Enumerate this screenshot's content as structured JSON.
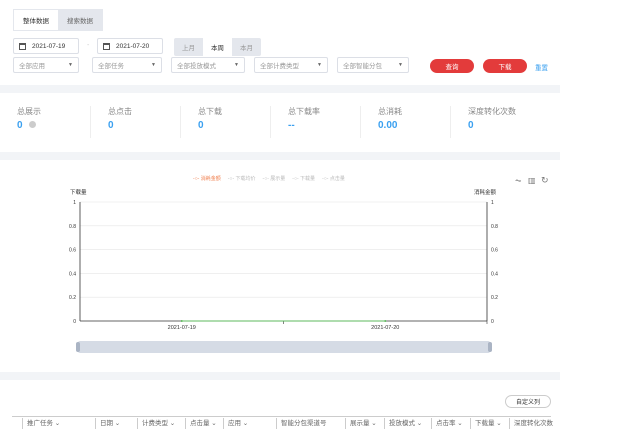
{
  "tabs": [
    "整体数据",
    "搜索数据"
  ],
  "filters": {
    "start_date": "2021-07-19",
    "end_date": "2021-07-20",
    "date_sep": "-",
    "periods": [
      "上月",
      "本周",
      "本月"
    ],
    "selects": [
      "全部应用",
      "全部任务",
      "全部投放模式",
      "全部计费类型",
      "全部智能分包"
    ],
    "query": "查询",
    "download": "下载",
    "reset": "重置"
  },
  "stats": [
    {
      "label": "总展示",
      "value": "0"
    },
    {
      "label": "总点击",
      "value": "0"
    },
    {
      "label": "总下载",
      "value": "0"
    },
    {
      "label": "总下载率",
      "value": "--"
    },
    {
      "label": "总消耗",
      "value": "0.00"
    },
    {
      "label": "深度转化次数",
      "value": "0"
    }
  ],
  "chart_data": {
    "type": "line",
    "legend": [
      "消耗金额",
      "下载均价",
      "展示量",
      "下载量",
      "点击量"
    ],
    "active_series": "消耗金额",
    "ylabel_left": "下载量",
    "ylabel_right": "消耗金额",
    "x": [
      "2021-07-19",
      "2021-07-20"
    ],
    "yticks": [
      "0",
      "0.2",
      "0.4",
      "0.6",
      "0.8",
      "1"
    ],
    "ylim": [
      0,
      1
    ],
    "series": [
      {
        "name": "消耗金额",
        "values": [
          0,
          0
        ]
      }
    ]
  },
  "table": {
    "custom_columns": "自定义列",
    "columns": [
      "推广任务",
      "日期",
      "计费类型",
      "点击量",
      "应用",
      "智能分包渠道号",
      "展示量",
      "投放模式",
      "点击率",
      "下载量",
      "深度转化次数"
    ]
  }
}
